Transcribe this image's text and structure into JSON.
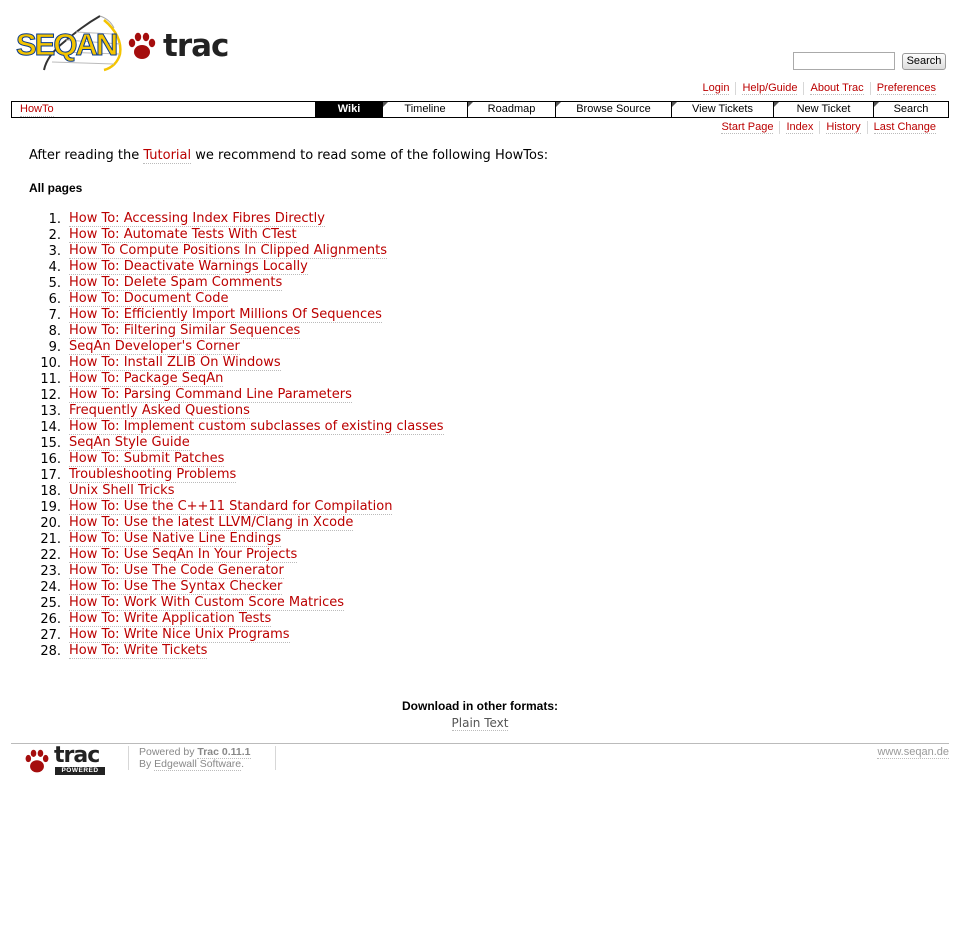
{
  "brand": {
    "logo_text_left": "SEQAN",
    "logo_text_right": "trac"
  },
  "search": {
    "placeholder": "",
    "value": "",
    "button_label": "Search"
  },
  "metanav": [
    "Login",
    "Help/Guide",
    "About Trac",
    "Preferences"
  ],
  "mainnav": {
    "context": "HowTo",
    "tabs": [
      "Wiki",
      "Timeline",
      "Roadmap",
      "Browse Source",
      "View Tickets",
      "New Ticket",
      "Search"
    ],
    "active": "Wiki"
  },
  "ctxtnav": [
    "Start Page",
    "Index",
    "History",
    "Last Change"
  ],
  "intro": {
    "before": "After reading the ",
    "link": "Tutorial",
    "after": " we recommend to read some of the following HowTos:"
  },
  "all_pages_heading": "All pages",
  "howtos": [
    "How To: Accessing Index Fibres Directly",
    "How To: Automate Tests With CTest",
    "How To Compute Positions In Clipped Alignments",
    "How To: Deactivate Warnings Locally",
    "How To: Delete Spam Comments",
    "How To: Document Code",
    "How To: Efficiently Import Millions Of Sequences",
    "How To: Filtering Similar Sequences",
    "SeqAn Developer's Corner",
    "How To: Install ZLIB On Windows",
    "How To: Package SeqAn",
    "How To: Parsing Command Line Parameters",
    "Frequently Asked Questions",
    "How To: Implement custom subclasses of existing classes",
    "SeqAn Style Guide",
    "How To: Submit Patches",
    "Troubleshooting Problems",
    "Unix Shell Tricks",
    "How To: Use the C++11 Standard for Compilation",
    "How To: Use the latest LLVM/Clang in Xcode",
    "How To: Use Native Line Endings",
    "How To: Use SeqAn In Your Projects",
    "How To: Use The Code Generator",
    "How To: Use The Syntax Checker",
    "How To: Work With Custom Score Matrices",
    "How To: Write Application Tests",
    "How To: Write Nice Unix Programs",
    "How To: Write Tickets"
  ],
  "altlinks": {
    "heading": "Download in other formats:",
    "formats": [
      "Plain Text"
    ]
  },
  "footer": {
    "logo_text": "trac",
    "logo_badge": "POWERED",
    "powered_by": "Powered by ",
    "trac_version": "Trac 0.11.1",
    "by": "By ",
    "edgewall": "Edgewall Software",
    "period": ".",
    "site": "www.seqan.de"
  },
  "colors": {
    "link": "#bb0000",
    "active_tab_bg": "#000000",
    "logo_yellow": "#f4c400",
    "logo_blue": "#0a3a8c"
  }
}
